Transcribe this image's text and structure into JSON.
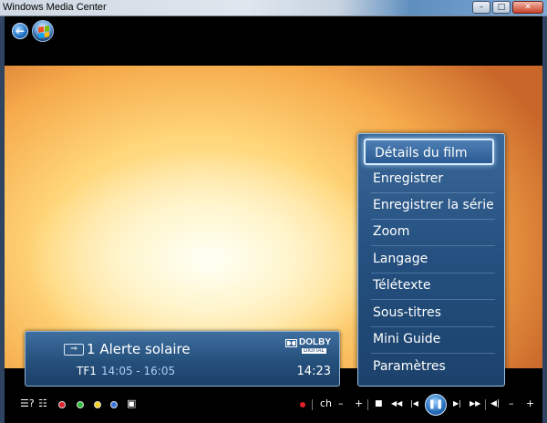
{
  "window": {
    "title": "Windows Media Center",
    "minimize": "–",
    "maximize": "□",
    "close": "✕"
  },
  "nav": {
    "back_icon": "←"
  },
  "info_panel": {
    "program_number": "1",
    "program_title": "Alerte solaire",
    "channel": "TF1",
    "time_range": "14:05 - 16:05",
    "clock": "14:23",
    "dolby_name": "DOLBY",
    "dolby_sub": "DIGITAL"
  },
  "context_menu": {
    "items": [
      {
        "label": "Détails du film",
        "selected": true
      },
      {
        "label": "Enregistrer"
      },
      {
        "label": "Enregistrer la série"
      },
      {
        "label": "Zoom"
      },
      {
        "label": "Langage"
      },
      {
        "label": "Télétexte"
      },
      {
        "label": "Sous-titres"
      },
      {
        "label": "Mini Guide"
      },
      {
        "label": "Paramètres"
      }
    ]
  },
  "controls": {
    "guide_icon": "☰?",
    "list_icon": "☷",
    "channel_label": "ch",
    "minus": "–",
    "plus": "+",
    "stop": "■",
    "rewind": "◀◀",
    "prev": "|◀",
    "pause": "❚❚",
    "next": "▶|",
    "forward": "▶▶",
    "mute": "◀|",
    "vol_minus": "–",
    "vol_plus": "+",
    "colors": {
      "red": "#e0202a",
      "green": "#2fbf3a",
      "yellow": "#f0d020",
      "blue": "#3a78e0",
      "record": "#e0202a"
    }
  }
}
